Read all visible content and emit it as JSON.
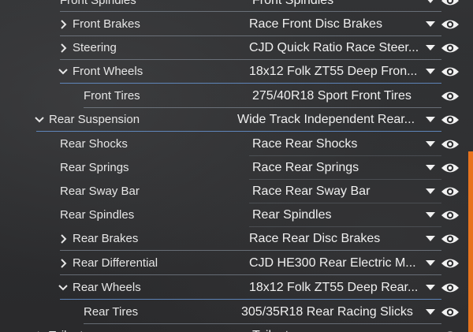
{
  "rows": [
    {
      "label": "Front Spindles",
      "value": "Front Spindles"
    },
    {
      "label": "Front Brakes",
      "value": "Race Front Disc Brakes"
    },
    {
      "label": "Steering",
      "value": "CJD Quick Ratio Race Steer..."
    },
    {
      "label": "Front Wheels",
      "value": "18x12 Folk ZT55 Deep Fron..."
    },
    {
      "label": "Front Tires",
      "value": "275/40R18 Sport Front Tires"
    },
    {
      "label": "Rear Suspension",
      "value": "Wide Track Independent Rear..."
    },
    {
      "label": "Rear Shocks",
      "value": "Race Rear Shocks"
    },
    {
      "label": "Rear Springs",
      "value": "Race Rear Springs"
    },
    {
      "label": "Rear Sway Bar",
      "value": "Race Rear Sway Bar"
    },
    {
      "label": "Rear Spindles",
      "value": "Rear Spindles"
    },
    {
      "label": "Rear Brakes",
      "value": "Race Rear Disc Brakes"
    },
    {
      "label": "Rear Differential",
      "value": "CJD HE300 Rear Electric M..."
    },
    {
      "label": "Rear Wheels",
      "value": "18x12 Folk ZT55 Deep Rear..."
    },
    {
      "label": "Rear Tires",
      "value": "305/35R18 Rear Racing Slicks"
    },
    {
      "label": "Tailgate",
      "value": "Tailgate"
    }
  ],
  "icons": {
    "expand": "chevron-right-icon",
    "collapse": "chevron-down-icon",
    "dropdown": "caret-down-icon",
    "visibility": "eye-icon"
  },
  "colors": {
    "text": "#e6e6e6",
    "separator": "#96a0af",
    "separator_active": "#6ea0e6",
    "scroll_accent": "#e7731d"
  }
}
